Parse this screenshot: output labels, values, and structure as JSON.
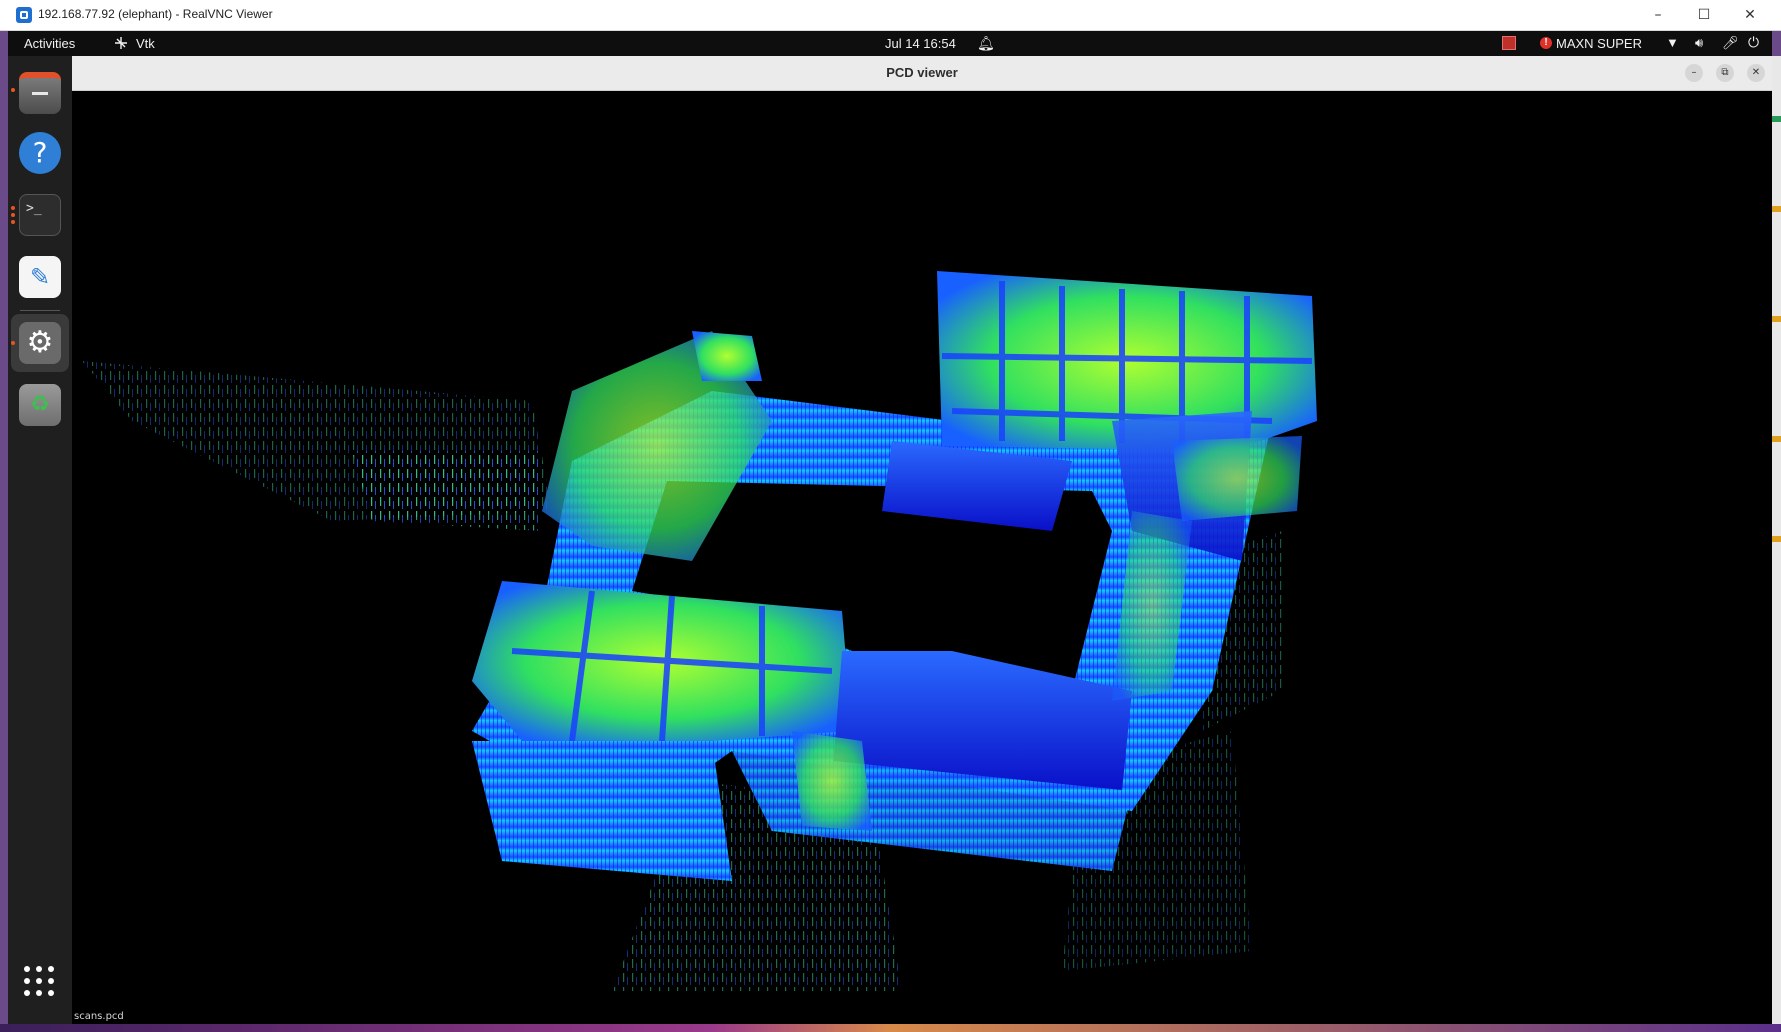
{
  "vnc_window": {
    "title": "192.168.77.92 (elephant) - RealVNC Viewer",
    "controls": {
      "minimize": "–",
      "maximize": "☐",
      "close": "✕"
    }
  },
  "topbar": {
    "activities": "Activities",
    "app_label": "Vtk",
    "clock": "Jul 14  16:54",
    "power_mode": "MAXN SUPER",
    "icons": [
      "bell-icon",
      "wifi-icon",
      "volume-icon",
      "microphone-icon",
      "power-icon"
    ]
  },
  "dock": {
    "items": [
      "files",
      "help",
      "terminal",
      "text-editor",
      "settings",
      "trash",
      "show-applications"
    ],
    "help_glyph": "?",
    "terminal_glyph": ">_"
  },
  "pcd_window": {
    "title": "PCD viewer",
    "file_label": "scans.pcd"
  },
  "colors": {
    "cloud_low": "#1a1aff",
    "cloud_mid": "#00c8ff",
    "cloud_high": "#a0ff20",
    "background": "#000000"
  }
}
